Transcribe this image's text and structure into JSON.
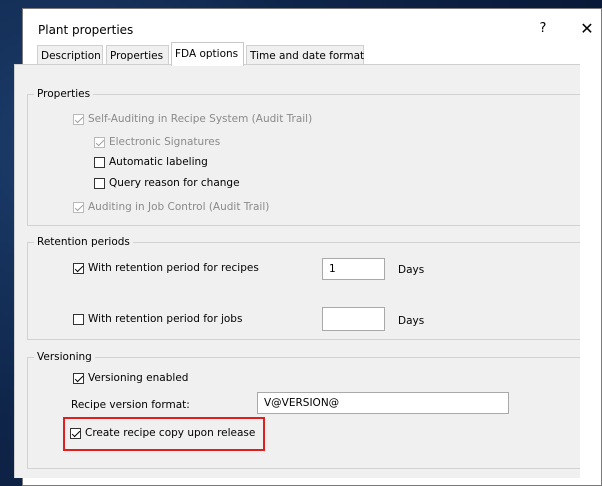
{
  "dialog": {
    "title": "Plant properties",
    "help_label": "?",
    "close_label": "✕"
  },
  "tabs": [
    {
      "label": "Description",
      "active": false
    },
    {
      "label": "Properties",
      "active": false
    },
    {
      "label": "FDA options",
      "active": true
    },
    {
      "label": "Time and date format",
      "active": false
    }
  ],
  "properties_group": {
    "title": "Properties",
    "items": [
      {
        "label": "Self-Auditing in Recipe System (Audit Trail)",
        "checked": true,
        "enabled": false
      },
      {
        "label": "Electronic Signatures",
        "checked": true,
        "enabled": false
      },
      {
        "label": "Automatic labeling",
        "checked": false,
        "enabled": true
      },
      {
        "label": "Query reason for change",
        "checked": false,
        "enabled": true
      },
      {
        "label": "Auditing in Job Control (Audit Trail)",
        "checked": true,
        "enabled": false
      }
    ]
  },
  "retention_group": {
    "title": "Retention periods",
    "recipes": {
      "label": "With retention period for recipes",
      "checked": true,
      "value": "1",
      "unit": "Days"
    },
    "jobs": {
      "label": "With retention period for jobs",
      "checked": false,
      "value": "",
      "unit": "Days"
    }
  },
  "versioning_group": {
    "title": "Versioning",
    "enabled_label": "Versioning enabled",
    "format_label": "Recipe version format:",
    "format_value": "V@VERSION@",
    "copy_label": "Create recipe copy upon release"
  },
  "colors": {
    "highlight": "#e01e1e",
    "background": "#0e2448"
  }
}
